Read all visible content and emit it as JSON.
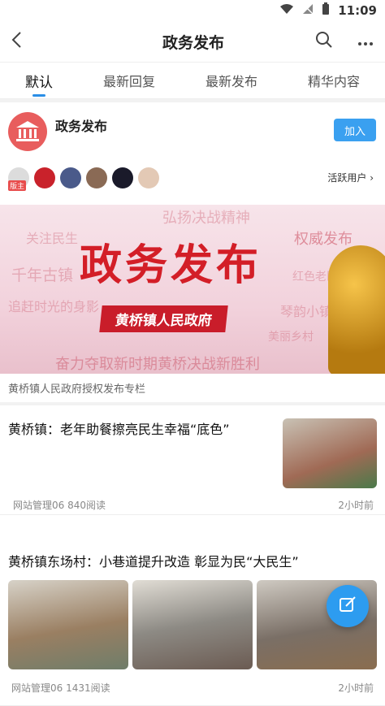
{
  "status": {
    "time": "11:09",
    "icons": [
      "wifi-icon",
      "signal-off-icon",
      "battery-icon"
    ]
  },
  "nav": {
    "title": "政务发布",
    "icons": [
      "back-icon",
      "search-icon",
      "more-icon"
    ]
  },
  "tabs": [
    {
      "label": "默认",
      "active": true
    },
    {
      "label": "最新回复",
      "active": false
    },
    {
      "label": "最新发布",
      "active": false
    },
    {
      "label": "精华内容",
      "active": false
    }
  ],
  "forum": {
    "name": "政务发布",
    "join_label": "加入",
    "moderator_badge": "版主",
    "active_users": "活跃用户"
  },
  "banner": {
    "title": "政务发布",
    "subtitle": "黄桥镇人民政府",
    "bg_texts": [
      "关注民生",
      "弘扬决战精神",
      "权威发布",
      "千年古镇",
      "追赶时光的身影",
      "红色老区",
      "琴韵小镇",
      "美丽乡村",
      "奋力夺取新时期黄桥决战新胜利"
    ]
  },
  "caption": "黄桥镇人民政府授权发布专栏",
  "posts": [
    {
      "title": "黄桥镇：老年助餐擦亮民生幸福“底色”",
      "author_reads": "网站管理06 840阅读",
      "time": "2小时前"
    },
    {
      "title": "黄桥镇东场村：小巷道提升改造 彰显为民“大民生”",
      "author_reads": "网站管理06 1431阅读",
      "time": "2小时前"
    }
  ],
  "colors": {
    "accent": "#2a8ee6",
    "join": "#3aa0f0",
    "logo": "#e85d5d",
    "banner_red": "#d31e27"
  }
}
